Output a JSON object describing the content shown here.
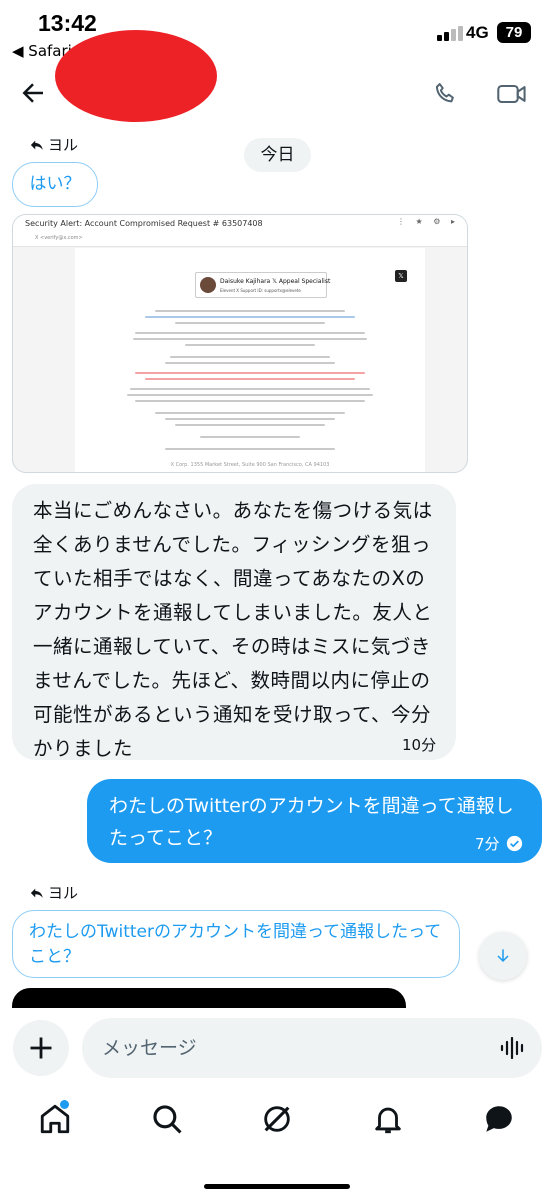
{
  "status": {
    "time": "13:42",
    "back_app": "◀ Safari",
    "network": "4G",
    "battery": "79"
  },
  "header": {
    "back_label": "back"
  },
  "date_divider": "今日",
  "reply1": {
    "label": "ヨル",
    "quoted": "はい？"
  },
  "screenshot": {
    "title": "Security Alert: Account Compromised Request # 63507408",
    "sender": "X <verify@x.com>",
    "name": "Daisuke Kajihara 𝕏 Appeal Specialist",
    "role": "Elevent X Support ID: supportx@elevete",
    "footer": "X Corp. 1355 Market Street, Suite 900 San Francisco, CA 94103",
    "logo": "𝕏"
  },
  "received": {
    "text": "本当にごめんなさい。あなたを傷つける気は全くありませんでした。フィッシングを狙っていた相手ではなく、間違ってあなたのXのアカウントを通報してしまいました。友人と一緒に通報していて、その時はミスに気づきませんでした。先ほど、数時間以内に停止の可能性があるという通知を受け取って、今分かりました",
    "time": "10分"
  },
  "sent": {
    "text": "わたしのTwitterのアカウントを間違って通報したってこと？",
    "time": "7分"
  },
  "reply2": {
    "label": "ヨル",
    "quoted": "わたしのTwitterのアカウントを間違って通報したってこと？"
  },
  "composer": {
    "placeholder": "メッセージ"
  },
  "colors": {
    "accent": "#1d9bf0",
    "bubble_gray": "#eff3f4",
    "redaction": "#ed2226"
  }
}
